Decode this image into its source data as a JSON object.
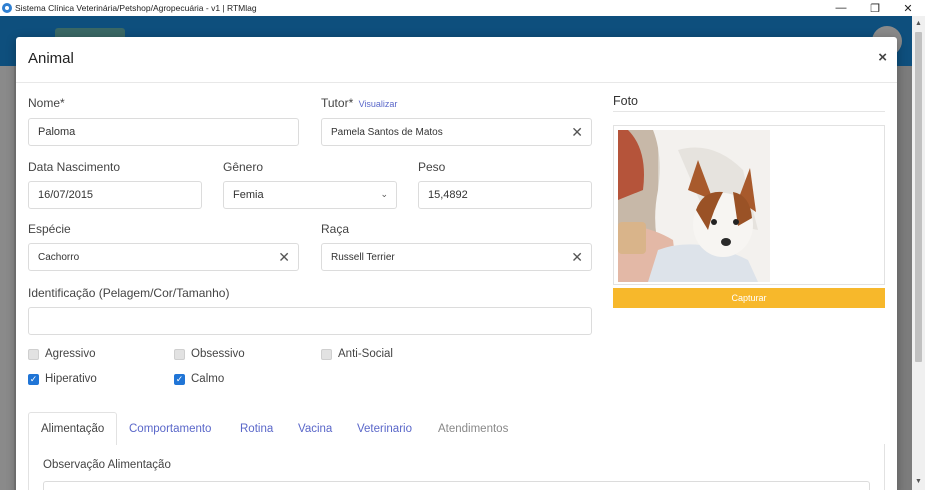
{
  "window": {
    "title": "Sistema Clínica Veterinária/Petshop/Agropecuária - v1 | RTMlag"
  },
  "modal": {
    "title": "Animal",
    "close": "×"
  },
  "form": {
    "nome": {
      "label": "Nome*",
      "value": "Paloma"
    },
    "tutor": {
      "label": "Tutor*",
      "link": "Visualizar",
      "value": "Pamela Santos de Matos"
    },
    "nascimento": {
      "label": "Data Nascimento",
      "value": "16/07/2015"
    },
    "genero": {
      "label": "Gênero",
      "value": "Femia"
    },
    "peso": {
      "label": "Peso",
      "value": "15,4892"
    },
    "especie": {
      "label": "Espécie",
      "value": "Cachorro"
    },
    "raca": {
      "label": "Raça",
      "value": "Russell Terrier"
    },
    "identificacao": {
      "label": "Identificação (Pelagem/Cor/Tamanho)",
      "value": ""
    },
    "checkboxes": [
      {
        "label": "Agressivo",
        "checked": false
      },
      {
        "label": "Obsessivo",
        "checked": false
      },
      {
        "label": "Anti-Social",
        "checked": false
      },
      {
        "label": "Hiperativo",
        "checked": true
      },
      {
        "label": "Calmo",
        "checked": true
      }
    ]
  },
  "foto": {
    "title": "Foto",
    "capture_label": "Capturar"
  },
  "tabs": [
    {
      "label": "Alimentação",
      "active": true
    },
    {
      "label": "Comportamento",
      "active": false
    },
    {
      "label": "Rotina",
      "active": false
    },
    {
      "label": "Vacina",
      "active": false
    },
    {
      "label": "Veterinario",
      "active": false
    },
    {
      "label": "Atendimentos",
      "active": false
    }
  ],
  "tab_pane": {
    "label": "Observação Alimentação"
  },
  "colors": {
    "primary": "#2075d6",
    "capture": "#f7b82b",
    "link": "#5a67c9",
    "header": "#0e4f7d"
  }
}
